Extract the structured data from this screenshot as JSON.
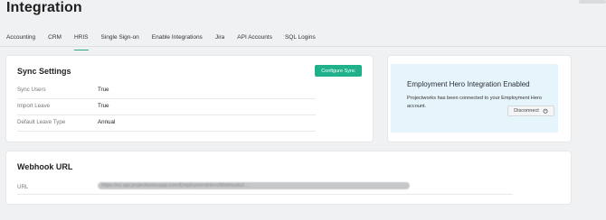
{
  "page": {
    "title": "Integration"
  },
  "tabs": [
    {
      "label": "Accounting",
      "active": false
    },
    {
      "label": "CRM",
      "active": false
    },
    {
      "label": "HRIS",
      "active": true
    },
    {
      "label": "Single Sign-on",
      "active": false
    },
    {
      "label": "Enable Integrations",
      "active": false
    },
    {
      "label": "Jira",
      "active": false
    },
    {
      "label": "API Accounts",
      "active": false
    },
    {
      "label": "SQL Logins",
      "active": false
    }
  ],
  "sync_settings": {
    "title": "Sync Settings",
    "configure_label": "Configure Sync",
    "rows": [
      {
        "label": "Sync Users",
        "value": "True"
      },
      {
        "label": "Import Leave",
        "value": "True"
      },
      {
        "label": "Default Leave Type",
        "value": "Annual"
      }
    ]
  },
  "employment_hero": {
    "title": "Employment Hero Integration Enabled",
    "description": "Projectworks has been connected to your Employment Hero account.",
    "disconnect_label": "Disconnect"
  },
  "webhook": {
    "title": "Webhook URL",
    "url_label": "URL",
    "url_value": "https://nz-api.projectworksapp.com/EmploymentHero/Webhooks/..."
  },
  "colors": {
    "accent": "#20b08a",
    "panel": "#e6f4fb",
    "background": "#f0f1f3"
  }
}
